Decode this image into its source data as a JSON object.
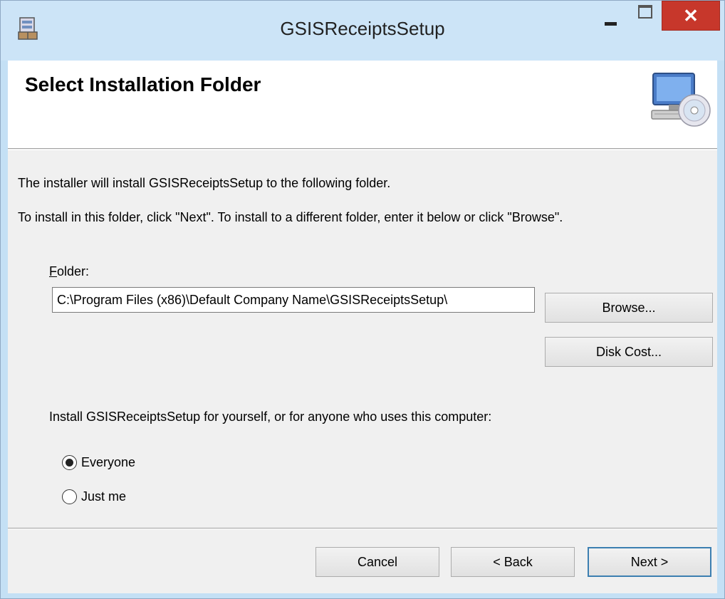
{
  "window": {
    "title": "GSISReceiptsSetup",
    "close_symbol": "✕"
  },
  "banner": {
    "title": "Select Installation Folder",
    "icon": "computer-cd-icon"
  },
  "body": {
    "line1": "The installer will install GSISReceiptsSetup to the following folder.",
    "line2": "To install in this folder, click \"Next\". To install to a different folder, enter it below or click \"Browse\".",
    "folder_label_accel": "F",
    "folder_label_rest": "older:",
    "folder_value": "C:\\Program Files (x86)\\Default Company Name\\GSISReceiptsSetup\\",
    "browse_label": "Browse...",
    "disk_cost_label": "Disk Cost...",
    "install_for_text": "Install GSISReceiptsSetup for yourself, or for anyone who uses this computer:",
    "options": {
      "everyone": {
        "label": "Everyone",
        "checked": true
      },
      "just_me": {
        "label": "Just me",
        "checked": false
      }
    }
  },
  "footer": {
    "cancel_label": "Cancel",
    "back_label": "< Back",
    "next_label": "Next >"
  },
  "colors": {
    "titlebar": "#cce4f7",
    "close": "#c7372b",
    "default_button_border": "#3c7fb1"
  }
}
